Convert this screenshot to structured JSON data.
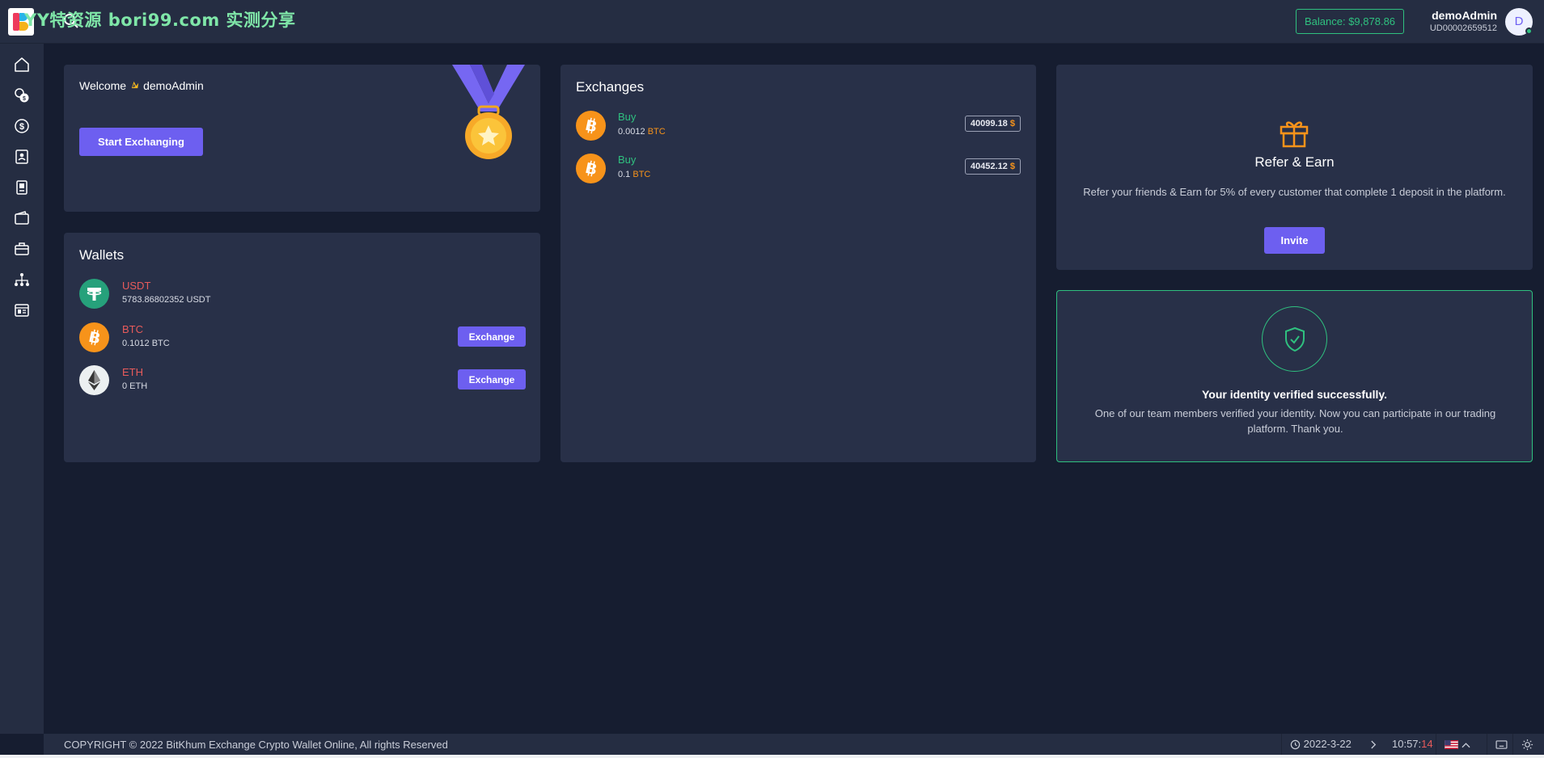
{
  "watermark": "YY特资源 bori99.com 实测分享",
  "header": {
    "balance": "Balance: $9,878.86",
    "user_name": "demoAdmin",
    "user_id": "UD00002659512",
    "avatar_initial": "D"
  },
  "sidebar": {
    "items": [
      "home-icon",
      "coins-icon",
      "dollar-icon",
      "contacts-icon",
      "document-icon",
      "wallet-icon",
      "briefcase-icon",
      "network-icon",
      "report-icon"
    ]
  },
  "welcome": {
    "prefix": "Welcome",
    "name": "demoAdmin",
    "start_label": "Start Exchanging"
  },
  "wallets": {
    "title": "Wallets",
    "exchange_label": "Exchange",
    "items": [
      {
        "name": "USDT",
        "amount": "5783.86802352 USDT",
        "color": "#26a17b"
      },
      {
        "name": "BTC",
        "amount": "0.1012 BTC",
        "color": "#f7931a"
      },
      {
        "name": "ETH",
        "amount": "0 ETH",
        "color": "#ecf0f1"
      }
    ]
  },
  "exchanges": {
    "title": "Exchanges",
    "items": [
      {
        "type": "Buy",
        "amount": "0.0012",
        "unit": "BTC",
        "price": "40099.18",
        "currency": "$"
      },
      {
        "type": "Buy",
        "amount": "0.1",
        "unit": "BTC",
        "price": "40452.12",
        "currency": "$"
      }
    ]
  },
  "refer": {
    "title": "Refer & Earn",
    "description": "Refer your friends & Earn for 5% of every customer that complete 1 deposit in the platform.",
    "invite_label": "Invite"
  },
  "verification": {
    "title": "Your identity verified successfully.",
    "description": "One of our team members verified your identity. Now you can participate in our trading platform. Thank you."
  },
  "footer": {
    "copyright": "COPYRIGHT © 2022 BitKhum Exchange Crypto Wallet Online, All rights Reserved",
    "date": "2022-3-22",
    "time_main": "10:57:",
    "time_sec": "14"
  },
  "colors": {
    "accent": "#6d5ff0",
    "success": "#2fc07f",
    "danger": "#e85b5b",
    "btc": "#f7931a",
    "background": "#161d30",
    "card": "#283048"
  }
}
